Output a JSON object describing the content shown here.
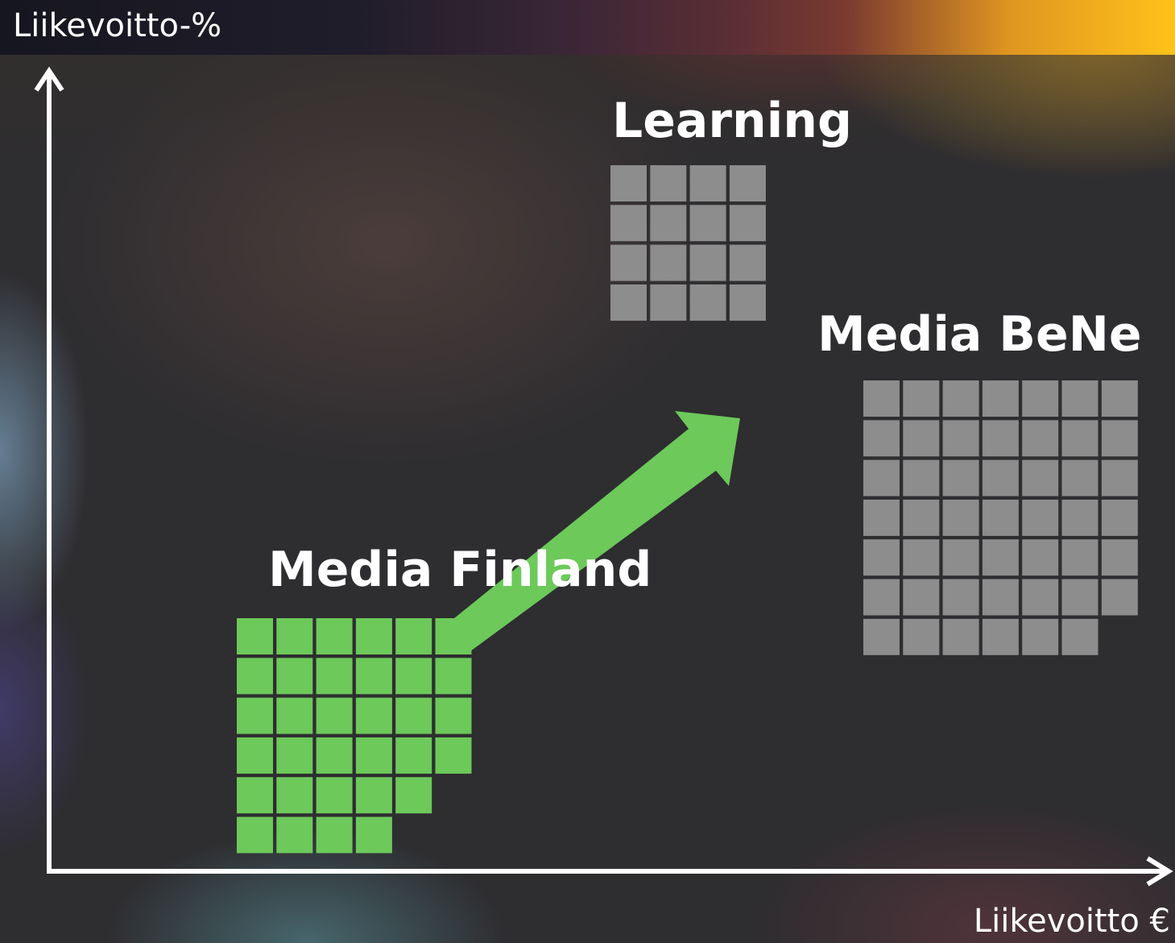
{
  "colors": {
    "text": "#ffffff",
    "axis": "#ffffff",
    "highlight_block": "#6cc95a",
    "neutral_block": "#8d8d8d",
    "arrow": "#6cc95a"
  },
  "axes": {
    "y_label": "Liikevoitto-%",
    "x_label": "Liikevoitto €"
  },
  "chart_data": {
    "type": "scatter",
    "xlabel": "Liikevoitto €",
    "ylabel": "Liikevoitto-%",
    "series": [
      {
        "name": "Learning",
        "blocks": 16,
        "rows": [
          4,
          4,
          4,
          4
        ],
        "color": "#8d8d8d"
      },
      {
        "name": "Media BeNe",
        "blocks": 48,
        "rows": [
          7,
          7,
          7,
          7,
          7,
          7,
          6
        ],
        "color": "#8d8d8d"
      },
      {
        "name": "Media Finland",
        "blocks": 31,
        "rows": [
          6,
          6,
          6,
          6,
          5,
          4
        ],
        "color": "#6cc95a",
        "growth_arrow": true
      }
    ]
  }
}
